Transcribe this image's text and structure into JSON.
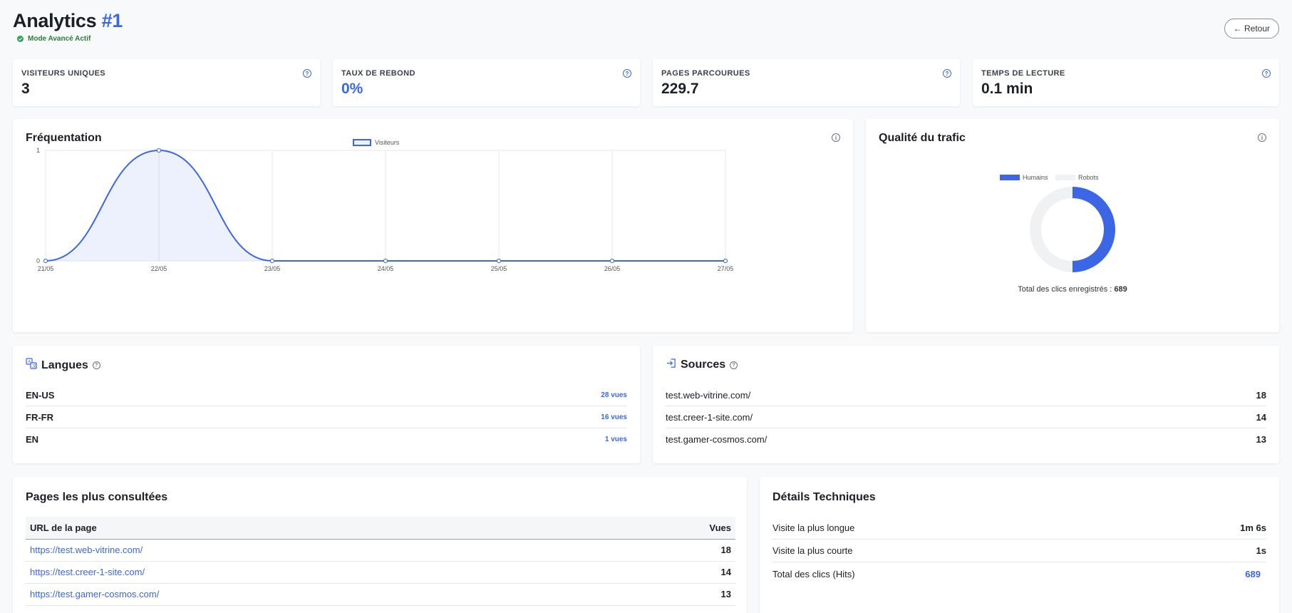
{
  "header": {
    "title": "Analytics",
    "title_id": "#1",
    "mode_label": "Mode Avancé Actif",
    "back_label": "← Retour"
  },
  "kpis": [
    {
      "label": "VISITEURS UNIQUES",
      "value": "3"
    },
    {
      "label": "TAUX DE REBOND",
      "value": "0%"
    },
    {
      "label": "PAGES PARCOURUES",
      "value": "229.7"
    },
    {
      "label": "TEMPS DE LECTURE",
      "value": "0.1 min"
    }
  ],
  "frequentation": {
    "title": "Fréquentation"
  },
  "chart_data": [
    {
      "type": "area",
      "title": "",
      "x": [
        "21/05",
        "22/05",
        "23/05",
        "24/05",
        "25/05",
        "26/05",
        "27/05"
      ],
      "series": [
        {
          "name": "Visiteurs",
          "values": [
            0,
            1,
            0,
            0,
            0,
            0,
            0
          ]
        }
      ],
      "y_ticks": [
        "0",
        "1"
      ],
      "ylim": [
        0,
        1
      ],
      "grid": true,
      "legend": "top-center",
      "color": "#3b66e6"
    },
    {
      "type": "pie",
      "title": "Qualité du trafic",
      "categories": [
        "Humains",
        "Robots"
      ],
      "values": [
        50,
        50
      ],
      "colors": [
        "#3b66e6",
        "#f0f1f3"
      ],
      "legend": "top-center"
    }
  ],
  "traffic": {
    "title": "Qualité du trafic",
    "total_label": "Total des clics enregistrés :",
    "total_value": "689"
  },
  "langues": {
    "title": "Langues",
    "rows": [
      {
        "code": "EN-US",
        "views": "28 vues"
      },
      {
        "code": "FR-FR",
        "views": "16 vues"
      },
      {
        "code": "EN",
        "views": "1 vues"
      }
    ]
  },
  "sources": {
    "title": "Sources",
    "rows": [
      {
        "url": "test.web-vitrine.com/",
        "count": "18"
      },
      {
        "url": "test.creer-1-site.com/",
        "count": "14"
      },
      {
        "url": "test.gamer-cosmos.com/",
        "count": "13"
      }
    ]
  },
  "pages": {
    "title": "Pages les plus consultées",
    "col_url": "URL de la page",
    "col_views": "Vues",
    "rows": [
      {
        "url": "https://test.web-vitrine.com/",
        "views": "18"
      },
      {
        "url": "https://test.creer-1-site.com/",
        "views": "14"
      },
      {
        "url": "https://test.gamer-cosmos.com/",
        "views": "13"
      }
    ]
  },
  "tech": {
    "title": "Détails Techniques",
    "rows": [
      {
        "label": "Visite la plus longue",
        "value": "1m 6s"
      },
      {
        "label": "Visite la plus courte",
        "value": "1s"
      },
      {
        "label": "Total des clics (Hits)",
        "value": "689"
      }
    ]
  },
  "colors": {
    "accent": "#3b66e6",
    "success": "#35a25a",
    "robots": "#f0f1f3"
  }
}
